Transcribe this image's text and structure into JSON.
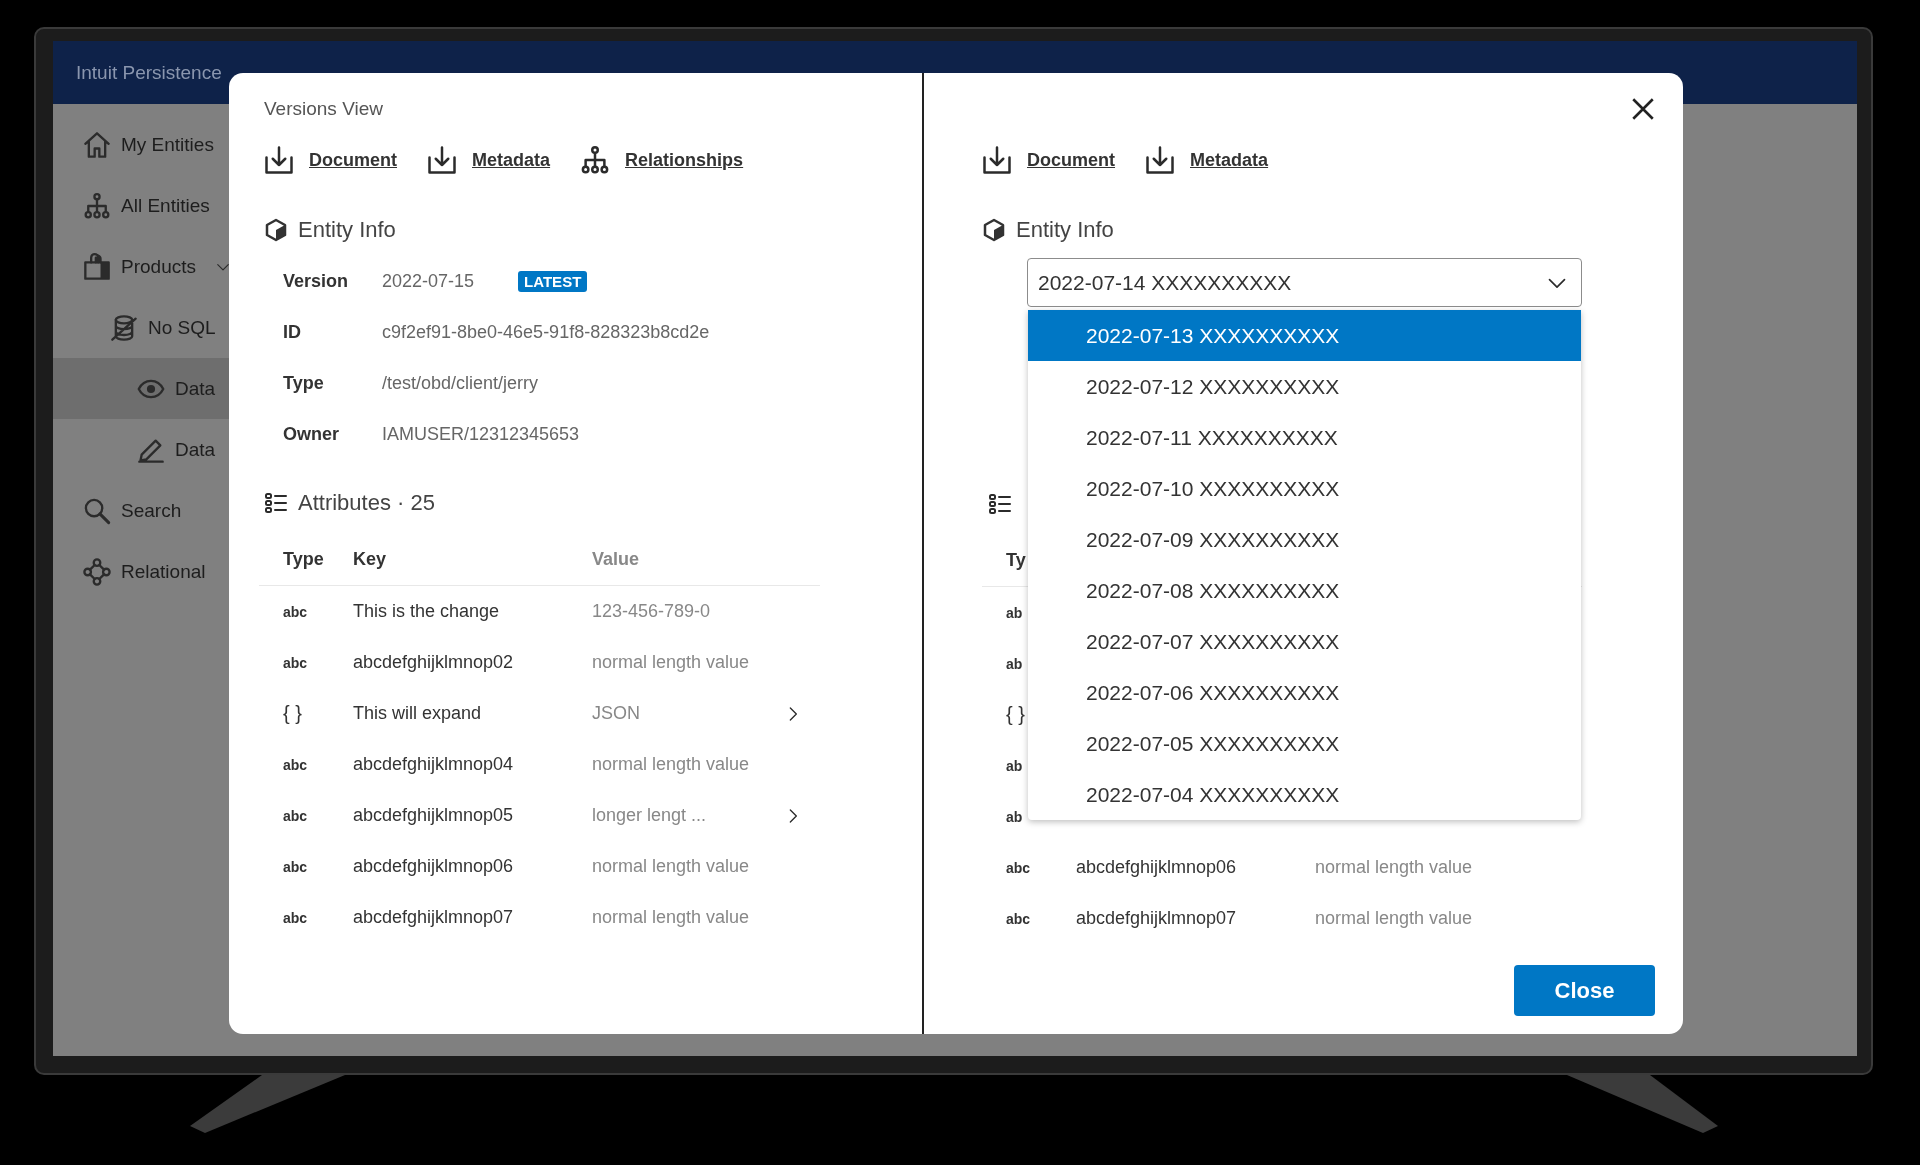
{
  "app_header": {
    "title": "Intuit Persistence"
  },
  "sidebar": {
    "items": [
      {
        "label": "My Entities",
        "selected": false
      },
      {
        "label": "All Entities",
        "selected": false
      },
      {
        "label": "Products",
        "selected": false,
        "expanded": true,
        "children": [
          {
            "label": "No SQL",
            "selected": false,
            "children": [
              {
                "label": "Data",
                "selected": true
              },
              {
                "label": "Data",
                "selected": false
              }
            ]
          }
        ]
      },
      {
        "label": "Search",
        "selected": false
      },
      {
        "label": "Relational",
        "selected": false
      }
    ]
  },
  "modal": {
    "left_pane": {
      "title": "Versions View",
      "links": [
        {
          "label": "Document",
          "kind": "download"
        },
        {
          "label": "Metadata",
          "kind": "download"
        },
        {
          "label": "Relationships",
          "kind": "hierarchy"
        }
      ],
      "entity_heading": "Entity Info",
      "info": [
        {
          "label": "Version",
          "value": "2022-07-15",
          "badge": "LATEST"
        },
        {
          "label": "ID",
          "value": "c9f2ef91-8be0-46e5-91f8-828323b8cd2e"
        },
        {
          "label": "Type",
          "value": "/test/obd/client/jerry"
        },
        {
          "label": "Owner",
          "value": "IAMUSER/12312345653"
        }
      ],
      "attributes_heading": "Attributes · 25",
      "columns": [
        "Type",
        "Key",
        "Value"
      ],
      "rows": [
        {
          "kind": "text",
          "type": "abc",
          "key": "This is the change",
          "value": "123-456-789-0",
          "expandable": false
        },
        {
          "kind": "text",
          "type": "abc",
          "key": "abcdefghijklmnop02",
          "value": "normal length value",
          "expandable": false
        },
        {
          "kind": "json",
          "type": "{ }",
          "key": "This will expand",
          "value": "JSON",
          "expandable": true
        },
        {
          "kind": "text",
          "type": "abc",
          "key": "abcdefghijklmnop04",
          "value": "normal length value",
          "expandable": false
        },
        {
          "kind": "text",
          "type": "abc",
          "key": "abcdefghijklmnop05",
          "value": "longer lengt ...",
          "expandable": true
        },
        {
          "kind": "text",
          "type": "abc",
          "key": "abcdefghijklmnop06",
          "value": "normal length value",
          "expandable": false
        },
        {
          "kind": "text",
          "type": "abc",
          "key": "abcdefghijklmnop07",
          "value": "normal length value",
          "expandable": false
        }
      ]
    },
    "right_pane": {
      "links": [
        {
          "label": "Document",
          "kind": "download"
        },
        {
          "label": "Metadata",
          "kind": "download"
        }
      ],
      "entity_heading": "Entity Info",
      "version_select": {
        "value": "2022-07-14 XXXXXXXXXX",
        "expanded": true,
        "options": [
          {
            "label": "2022-07-13 XXXXXXXXXX",
            "selected": true
          },
          {
            "label": "2022-07-12 XXXXXXXXXX",
            "selected": false
          },
          {
            "label": "2022-07-11 XXXXXXXXXX",
            "selected": false
          },
          {
            "label": "2022-07-10 XXXXXXXXXX",
            "selected": false
          },
          {
            "label": "2022-07-09 XXXXXXXXXX",
            "selected": false
          },
          {
            "label": "2022-07-08 XXXXXXXXXX",
            "selected": false
          },
          {
            "label": "2022-07-07 XXXXXXXXXX",
            "selected": false
          },
          {
            "label": "2022-07-06 XXXXXXXXXX",
            "selected": false
          },
          {
            "label": "2022-07-05 XXXXXXXXXX",
            "selected": false
          },
          {
            "label": "2022-07-04 XXXXXXXXXX",
            "selected": false
          }
        ]
      },
      "columns": [
        "Ty"
      ],
      "rows": [
        {
          "kind": "text",
          "type": "ab"
        },
        {
          "kind": "text",
          "type": "ab"
        },
        {
          "kind": "json",
          "type": "{ }"
        },
        {
          "kind": "text",
          "type": "ab"
        },
        {
          "kind": "text",
          "type": "ab"
        },
        {
          "kind": "text",
          "type": "abc",
          "key": "abcdefghijklmnop06",
          "value": "normal length value"
        },
        {
          "kind": "text",
          "type": "abc",
          "key": "abcdefghijklmnop07",
          "value": "normal length value"
        }
      ],
      "close_button": "Close"
    }
  }
}
